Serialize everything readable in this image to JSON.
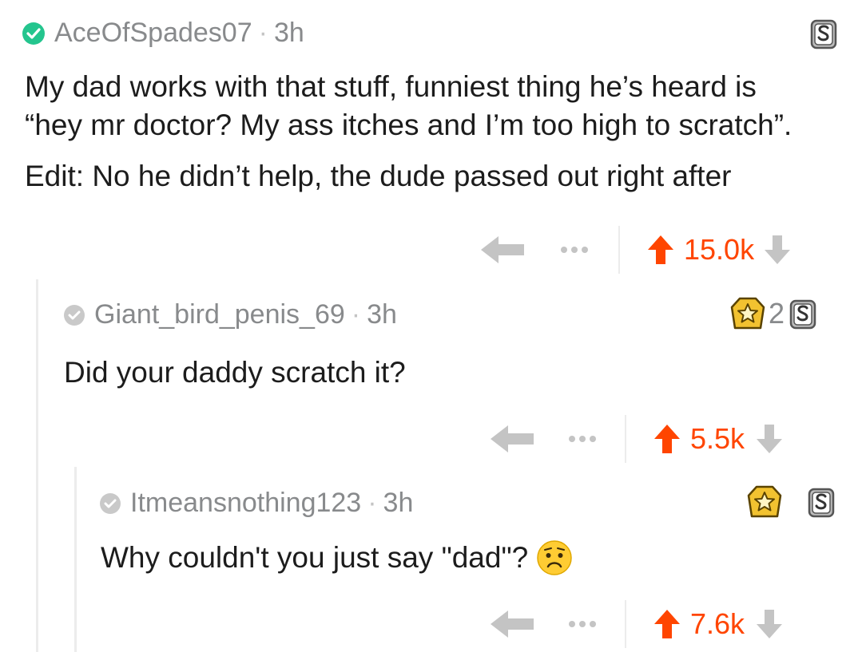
{
  "comments": [
    {
      "username": "AceOfSpades07",
      "time": "3h",
      "body_line1": "My dad works with that stuff, funniest thing he’s heard is",
      "body_line2": "“hey mr doctor? My ass itches and I’m too high to scratch”.",
      "body_edit": "Edit: No he didn’t help, the dude passed out right after",
      "score": "15.0k",
      "awards": [
        "silver-award"
      ]
    },
    {
      "username": "Giant_bird_penis_69",
      "time": "3h",
      "body": "Did your daddy scratch it?",
      "score": "5.5k",
      "award_count": "2",
      "awards": [
        "gold-award",
        "silver-award"
      ]
    },
    {
      "username": "Itmeansnothing123",
      "time": "3h",
      "body": "Why couldn't you just say \"dad\"?",
      "emoji": "worried-face",
      "score": "7.6k",
      "awards": [
        "gold-award",
        "silver-award"
      ]
    }
  ],
  "colors": {
    "upvote": "#ff4500",
    "verified": "#24c58e",
    "muted": "#888a8c"
  }
}
